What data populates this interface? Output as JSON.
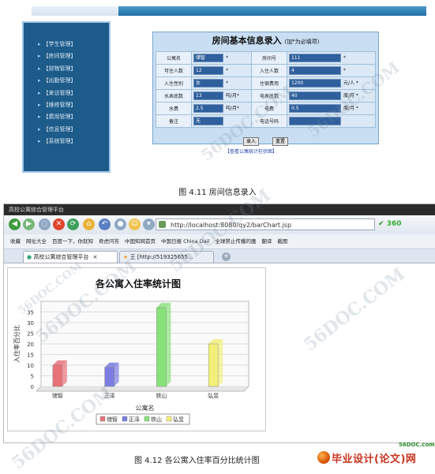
{
  "figure1": {
    "sidebar_items": [
      "【学生管理】",
      "【房间管理】",
      "【财物管理】",
      "【出勤管理】",
      "【来访管理】",
      "【维修管理】",
      "【费用管理】",
      "【信息管理】",
      "【系统管理】"
    ],
    "form_title": "房间基本信息录入",
    "form_note": "(加*为必填项)",
    "rows": [
      {
        "l1": "公寓名",
        "v1": "储智",
        "u1": "*",
        "l2": "房间号",
        "v2": "111",
        "u2": "*"
      },
      {
        "l1": "可住人数",
        "v1": "12",
        "u1": "*",
        "l2": "入住人数",
        "v2": "4",
        "u2": "*"
      },
      {
        "l1": "入住性别",
        "v1": "女",
        "u1": "*",
        "l2": "住宿费用",
        "v2": "1200",
        "u2": "元/人 *"
      },
      {
        "l1": "水表底数",
        "v1": "13",
        "u1": "吨/月*",
        "l2": "电表底数",
        "v2": "40",
        "u2": "度/月 *"
      },
      {
        "l1": "水费",
        "v1": "2.5",
        "u1": "吨/月*",
        "l2": "电费",
        "v2": "0.5",
        "u2": "度/月 *"
      },
      {
        "l1": "备注",
        "v1": "无",
        "u1": "",
        "l2": "电话号码",
        "v2": "",
        "u2": ""
      }
    ],
    "btn_submit": "录入",
    "btn_reset": "重置",
    "chart_link": "【查看公寓统计柱状图】",
    "caption": "图 4.11  房间信息录入"
  },
  "figure2": {
    "window_title": "高校公寓综合管理平台",
    "address": "http://localhost:8080/qy2/barChart.jsp",
    "brand": "360",
    "bookmarks": [
      "收藏",
      "网址大全",
      "百度一下，你就知",
      "奇虎问答",
      "中国知网首页",
      "中国日报 China Dail",
      "全球禁止传播的魔",
      "翻译",
      "截图"
    ],
    "tab1": "高校公寓综合管理平台",
    "tab2": "王 [http://519325655...",
    "caption": "图 4.12  各公寓入住率百分比统计图"
  },
  "logo": {
    "text": "毕业设计(论文)网",
    "url": "56DOC.com"
  },
  "watermark": "56DOC.COM",
  "chart_data": {
    "type": "bar",
    "title": "各公寓入住率统计图",
    "xlabel": "公寓名",
    "ylabel": "入住率百分比",
    "categories": [
      "储智",
      "正泽",
      "铁山",
      "弘昱"
    ],
    "values": [
      10,
      9,
      37,
      20
    ],
    "colors": [
      "#e8727a",
      "#7b7ee0",
      "#88e27a",
      "#f2ef7a"
    ],
    "ylim": [
      0,
      40
    ],
    "yticks": [
      0,
      5,
      10,
      15,
      20,
      25,
      30,
      35
    ],
    "legend": [
      "储智",
      "正泽",
      "铁山",
      "弘昱"
    ],
    "legend_position": "bottom",
    "grid": true
  }
}
